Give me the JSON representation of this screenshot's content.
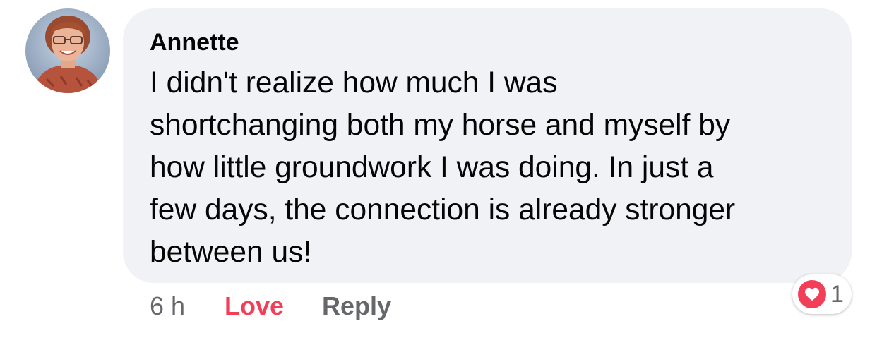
{
  "comment": {
    "author": "Annette",
    "text_lines": [
      "I didn't realize how much I was",
      "shortchanging both my horse and myself by",
      "how little groundwork I was doing. In just a",
      "few days, the connection is already stronger",
      "between us!"
    ]
  },
  "actions": {
    "time": "6 h",
    "love_label": "Love",
    "reply_label": "Reply"
  },
  "reactions": {
    "icon": "heart-icon",
    "count": "1",
    "color": "#f33e58"
  },
  "avatar": {
    "icon": "profile-photo"
  }
}
